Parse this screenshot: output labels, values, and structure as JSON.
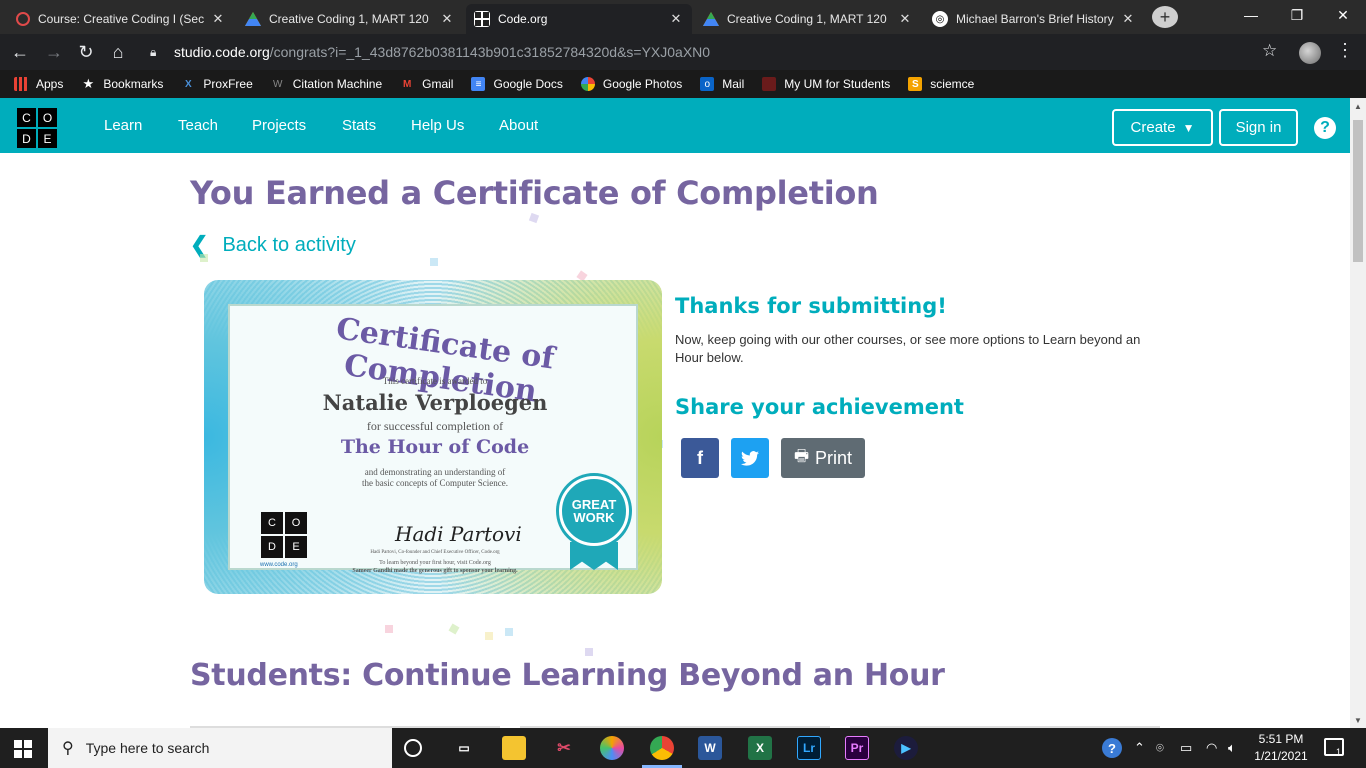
{
  "browser": {
    "tabs": [
      {
        "title": "Course: Creative Coding I (Sect",
        "active": false
      },
      {
        "title": "Creative Coding 1, MART 120 |",
        "active": false
      },
      {
        "title": "Code.org",
        "active": true
      },
      {
        "title": "Creative Coding 1, MART 120 |",
        "active": false
      },
      {
        "title": "Michael Barron's Brief History",
        "active": false
      }
    ],
    "url_host": "studio.code.org",
    "url_path": "/congrats?i=_1_43d8762b0381143b901c31852784320d&s=YXJ0aXN0",
    "bookmarks": [
      {
        "label": "Apps"
      },
      {
        "label": "Bookmarks"
      },
      {
        "label": "ProxFree"
      },
      {
        "label": "Citation Machine"
      },
      {
        "label": "Gmail"
      },
      {
        "label": "Google Docs"
      },
      {
        "label": "Google Photos"
      },
      {
        "label": "Mail"
      },
      {
        "label": "My UM for Students"
      },
      {
        "label": "sciemce"
      }
    ]
  },
  "header": {
    "logo": [
      "C",
      "O",
      "D",
      "E"
    ],
    "nav": [
      "Learn",
      "Teach",
      "Projects",
      "Stats",
      "Help Us",
      "About"
    ],
    "create_label": "Create",
    "signin_label": "Sign in",
    "help_glyph": "?",
    "brand_color": "#00adbc"
  },
  "main": {
    "title": "You Earned a Certificate of Completion",
    "back_label": "Back to activity",
    "certificate": {
      "heading": "Certificate of Completion",
      "awarded": "This certificate is awarded to",
      "name": "Natalie Verploegen",
      "for_line": "for successful completion of",
      "course": "The Hour of Code",
      "demo_line_1": "and demonstrating an understanding of",
      "demo_line_2": "the basic concepts of Computer Science.",
      "signature": "Hadi Partovi",
      "signer": "Hadi Partovi, Co-founder and Chief Executive Officer, Code.org",
      "footer_1": "To learn beyond your first hour, visit Code.org",
      "footer_2": "Sameer Gandhi made the generous gift to sponsor your learning.",
      "url": "www.code.org",
      "badge_line_1": "GREAT",
      "badge_line_2": "WORK"
    },
    "thanks": "Thanks for submitting!",
    "keep_going": "Now, keep going with our other courses, or see more options to Learn beyond an Hour below.",
    "share_title": "Share your achievement",
    "print_label": "Print",
    "section_title": "Students: Continue Learning Beyond an Hour"
  },
  "taskbar": {
    "search_placeholder": "Type here to search",
    "apps": [
      "Task View",
      "File Explorer",
      "Snip & Sketch",
      "Paint 3D",
      "Google Chrome",
      "Word",
      "Excel",
      "Lightroom",
      "Premiere Pro",
      "Media Player"
    ],
    "time": "5:51 PM",
    "date": "1/21/2021",
    "notification_count": "1"
  }
}
